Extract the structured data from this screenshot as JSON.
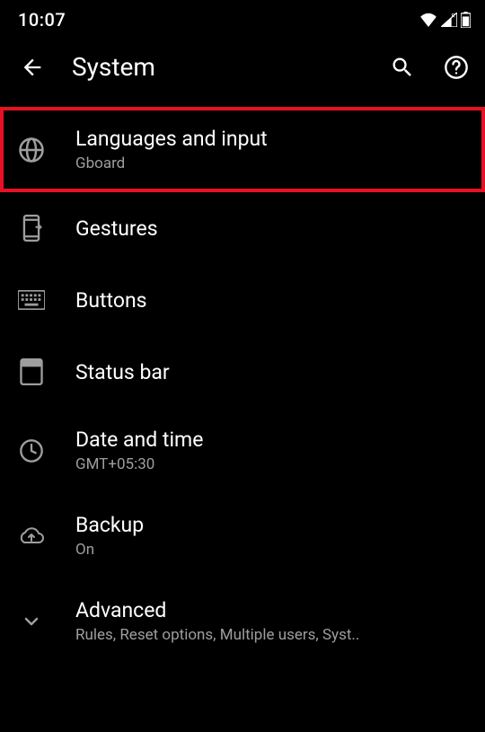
{
  "status": {
    "time": "10:07"
  },
  "header": {
    "title": "System"
  },
  "items": [
    {
      "title": "Languages and input",
      "subtitle": "Gboard",
      "highlighted": true
    },
    {
      "title": "Gestures",
      "subtitle": null
    },
    {
      "title": "Buttons",
      "subtitle": null
    },
    {
      "title": "Status bar",
      "subtitle": null
    },
    {
      "title": "Date and time",
      "subtitle": "GMT+05:30"
    },
    {
      "title": "Backup",
      "subtitle": "On"
    },
    {
      "title": "Advanced",
      "subtitle": "Rules, Reset options, Multiple users, Syst.."
    }
  ]
}
